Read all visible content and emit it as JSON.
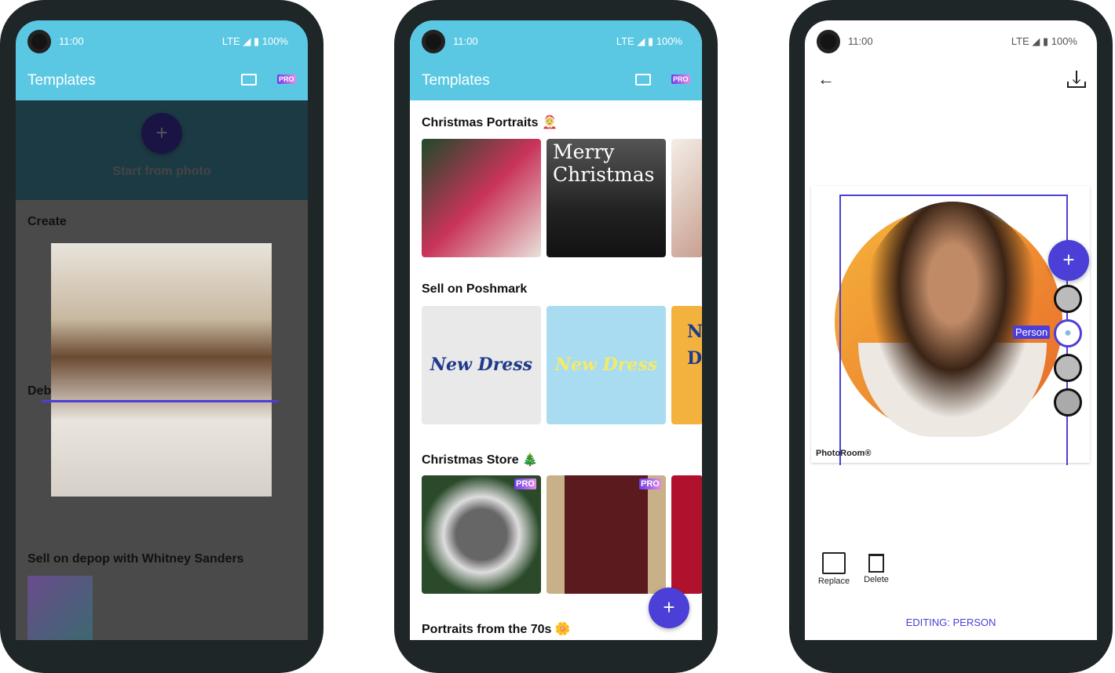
{
  "status": {
    "time": "11:00",
    "signal": "LTE ◢ ▮ 100%"
  },
  "phone1": {
    "title": "Templates",
    "pro_badge": "PRO",
    "start_from_photo": "Start from photo",
    "sections": [
      "Create",
      "Deb",
      "Sell on depop with Whitney Sanders"
    ]
  },
  "phone2": {
    "title": "Templates",
    "pro_badge": "PRO",
    "sections": [
      {
        "title": "Christmas Portraits 🤶",
        "cards": [
          "Merry Christmas"
        ]
      },
      {
        "title": "Sell on Poshmark",
        "cards": [
          "New Dress",
          "New Dress",
          "N D"
        ]
      },
      {
        "title": "Christmas Store 🎄",
        "badges": [
          "PRO",
          "PRO"
        ]
      },
      {
        "title": "Portraits from the 70s 🌼"
      }
    ],
    "fab": "+"
  },
  "phone3": {
    "watermark": "PhotoRoom®",
    "layer_label": "Person",
    "tools": [
      "Replace",
      "Delete"
    ],
    "editing": "EDITING: PERSON",
    "accent": "#4b3fd8"
  }
}
